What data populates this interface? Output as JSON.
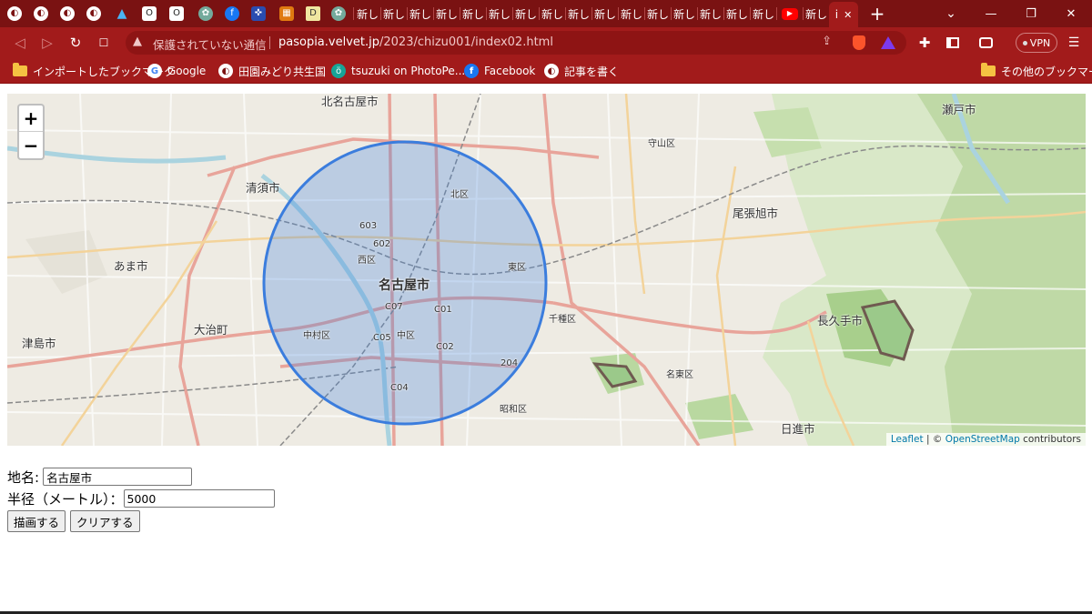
{
  "tabs": {
    "new_tab_label": "新し",
    "active_tab_label": "i",
    "close_glyph": "✕",
    "new_tab_button": "+",
    "tab_list_button": "⌄"
  },
  "window": {
    "minimize": "—",
    "maximize": "❐",
    "close": "✕"
  },
  "navigation": {
    "back": "◁",
    "forward": "▷",
    "reload": "↻",
    "bookmark": "☐",
    "security_warning": "保護されていない通信",
    "url_host": "pasopia.velvet.jp",
    "url_path": "/2023/chizu001/index02.html",
    "vpn_label": "VPN",
    "menu": "☰"
  },
  "bookmarks": [
    {
      "label": "インポートしたブックマーク",
      "icon": "folder-icon"
    },
    {
      "label": "Google",
      "icon": "google-icon"
    },
    {
      "label": "田園みどり共生国",
      "icon": "globe-icon"
    },
    {
      "label": "tsuzuki on PhotoPe...",
      "icon": "photopea-icon"
    },
    {
      "label": "Facebook",
      "icon": "facebook-icon"
    },
    {
      "label": "記事を書く",
      "icon": "globe-icon"
    }
  ],
  "other_bookmarks": "その他のブックマーク",
  "map": {
    "zoom_in": "+",
    "zoom_out": "−",
    "attribution_leaflet": "Leaflet",
    "attribution_sep": " | © ",
    "attribution_osm": "OpenStreetMap",
    "attribution_contributors": " contributors",
    "circle_color": "#3b7ddd",
    "labels": {
      "nagoya": "名古屋市",
      "kita_nagoya": "北名古屋市",
      "kiyosu": "清須市",
      "ama": "あま市",
      "oharu": "大治町",
      "tsushima": "津島市",
      "owariasahi": "尾張旭市",
      "nagakute": "長久手市",
      "nisshin": "日進市",
      "seto": "瀬戸市",
      "moriyama": "守山区",
      "kita_ku": "北区",
      "nishi_ku": "西区",
      "higashi_ku": "東区",
      "naka_ku": "中区",
      "nakamura_ku": "中村区",
      "chikusa_ku": "千種区",
      "meito_ku": "名東区",
      "showa_ku": "昭和区",
      "r603": "603",
      "r602": "602",
      "c07": "C07",
      "c01": "C01",
      "c05": "C05",
      "c02": "C02",
      "c04": "C04",
      "r204": "204"
    }
  },
  "form": {
    "place_label": "地名:",
    "place_value": "名古屋市",
    "radius_label": "半径（メートル）：",
    "radius_value": "5000",
    "draw_button": "描画する",
    "clear_button": "クリアする"
  }
}
